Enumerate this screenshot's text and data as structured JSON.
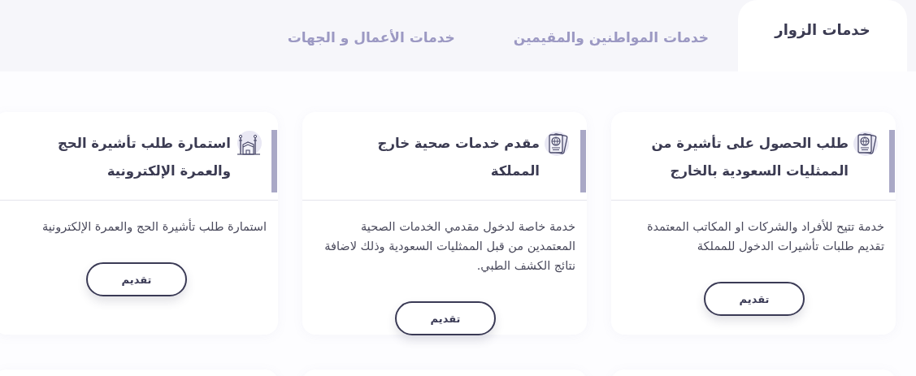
{
  "tabs": [
    {
      "label": "خدمات الزوار",
      "selected": true
    },
    {
      "label": "خدمات المواطنين والمقيمين",
      "selected": false
    },
    {
      "label": "خدمات الأعمال و الجهات",
      "selected": false
    }
  ],
  "cards": [
    {
      "kind": "passport",
      "title": "طلب الحصول على تأشيرة من الممثليات السعودية بالخارج",
      "description": "خدمة تتيح للأفراد والشركات او المكاتب المعتمدة تقديم طلبات تأشيرات الدخول للمملكة",
      "button": "تقديم"
    },
    {
      "kind": "passport",
      "title": "مقدم خدمات صحية خارج المملكة",
      "description": "خدمة خاصة لدخول مقدمي الخدمات الصحية المعتمدين من قبل الممثليات السعودية وذلك لاضافة نتائج الكشف الطبي.",
      "button": "تقديم"
    },
    {
      "kind": "kaaba",
      "title": "استمارة طلب تأشيرة الحج والعمرة الإلكترونية",
      "description": "استمارة طلب تأشيرة الحج والعمرة الإلكترونية",
      "button": "تقديم"
    }
  ]
}
